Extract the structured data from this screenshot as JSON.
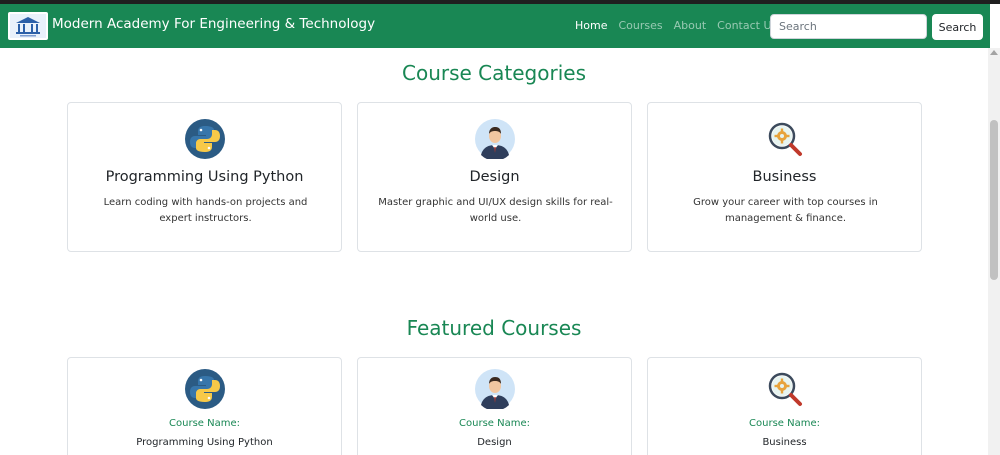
{
  "navbar": {
    "brand": "Modern Academy For Engineering & Technology",
    "links": [
      "Home",
      "Courses",
      "About",
      "Contact Us"
    ],
    "search_placeholder": "Search",
    "search_button": "Search"
  },
  "categories": {
    "title": "Course Categories",
    "items": [
      {
        "icon": "python-icon",
        "title": "Programming Using Python",
        "desc": "Learn coding with hands-on projects and expert instructors."
      },
      {
        "icon": "designer-avatar-icon",
        "title": "Design",
        "desc": "Master graphic and UI/UX design skills for real-world use."
      },
      {
        "icon": "gear-magnifier-icon",
        "title": "Business",
        "desc": "Grow your career with top courses in management & finance."
      }
    ]
  },
  "featured": {
    "title": "Featured Courses",
    "label": "Course Name:",
    "items": [
      {
        "icon": "python-icon",
        "name": "Programming Using Python"
      },
      {
        "icon": "designer-avatar-icon",
        "name": "Design"
      },
      {
        "icon": "gear-magnifier-icon",
        "name": "Business"
      }
    ]
  },
  "colors": {
    "brand": "#198754",
    "navbar_bg": "#198754"
  }
}
